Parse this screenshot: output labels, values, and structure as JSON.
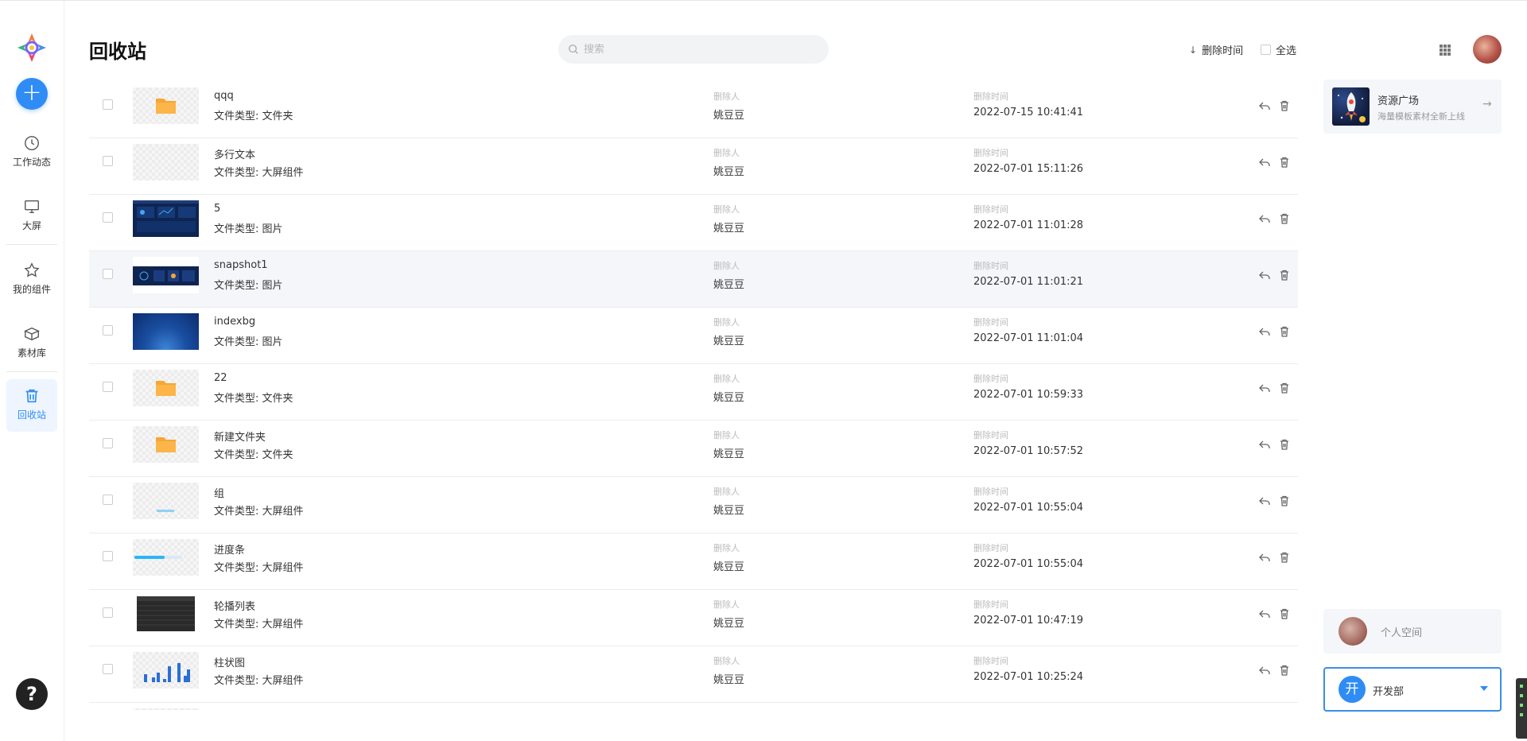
{
  "sidebar": {
    "items": [
      {
        "label": "工作动态",
        "icon": "clock-icon"
      },
      {
        "label": "大屏",
        "icon": "monitor-icon"
      },
      {
        "label": "我的组件",
        "icon": "star-icon"
      },
      {
        "label": "素材库",
        "icon": "box-icon"
      },
      {
        "label": "回收站",
        "icon": "trash-icon",
        "active": true
      }
    ],
    "add_label": "+",
    "help_label": "?"
  },
  "header": {
    "title": "回收站",
    "search_placeholder": "搜索",
    "sort_label": "删除时间",
    "select_all_label": "全选"
  },
  "columns": {
    "deleted_by": "删除人",
    "deleted_time": "删除时间"
  },
  "rows": [
    {
      "name": "qqq",
      "type": "文件类型: 文件夹",
      "by": "姚豆豆",
      "time": "2022-07-15 10:41:41",
      "thumb": "folder"
    },
    {
      "name": "多行文本",
      "type": "文件类型: 大屏组件",
      "by": "姚豆豆",
      "time": "2022-07-01 15:11:26",
      "thumb": "empty"
    },
    {
      "name": "5",
      "type": "文件类型: 图片",
      "by": "姚豆豆",
      "time": "2022-07-01 11:01:28",
      "thumb": "dashboard"
    },
    {
      "name": "snapshot1",
      "type": "文件类型: 图片",
      "by": "姚豆豆",
      "time": "2022-07-01 11:01:21",
      "thumb": "dashboard2"
    },
    {
      "name": "indexbg",
      "type": "文件类型: 图片",
      "by": "姚豆豆",
      "time": "2022-07-01 11:01:04",
      "thumb": "bluebg"
    },
    {
      "name": "22",
      "type": "文件类型: 文件夹",
      "by": "姚豆豆",
      "time": "2022-07-01 10:59:33",
      "thumb": "folder"
    },
    {
      "name": "新建文件夹",
      "type": "文件类型: 文件夹",
      "by": "姚豆豆",
      "time": "2022-07-01 10:57:52",
      "thumb": "folder"
    },
    {
      "name": "组",
      "type": "文件类型: 大屏组件",
      "by": "姚豆豆",
      "time": "2022-07-01 10:55:04",
      "thumb": "group"
    },
    {
      "name": "进度条",
      "type": "文件类型: 大屏组件",
      "by": "姚豆豆",
      "time": "2022-07-01 10:55:04",
      "thumb": "progress"
    },
    {
      "name": "轮播列表",
      "type": "文件类型: 大屏组件",
      "by": "姚豆豆",
      "time": "2022-07-01 10:47:19",
      "thumb": "table"
    },
    {
      "name": "柱状图",
      "type": "文件类型: 大屏组件",
      "by": "姚豆豆",
      "time": "2022-07-01 10:25:24",
      "thumb": "bars"
    }
  ],
  "right_panel": {
    "resource_title": "资源广场",
    "resource_sub": "海量模板素材全新上线",
    "personal_space": "个人空间",
    "dept_badge": "开",
    "dept_name": "开发部"
  },
  "colors": {
    "accent": "#2f8cf4",
    "folder": "#f7a635"
  }
}
